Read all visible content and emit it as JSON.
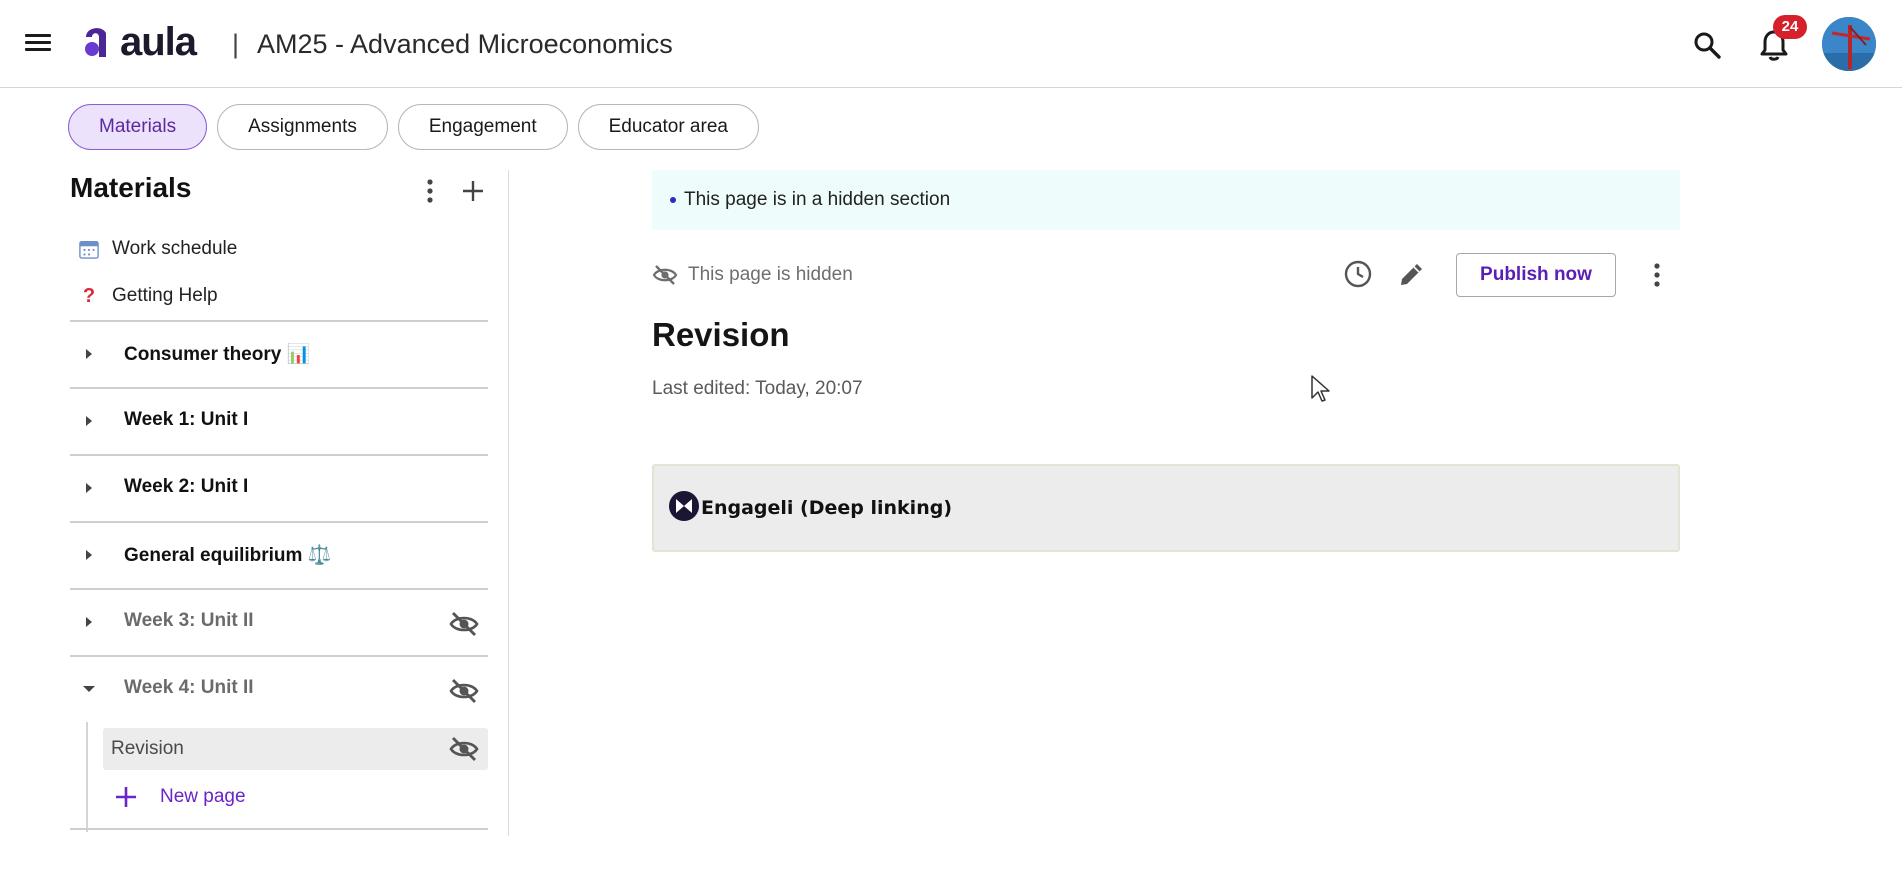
{
  "header": {
    "logo_text": "aula",
    "separator": "|",
    "course_title": "AM25 - Advanced Microeconomics",
    "notification_count": "24",
    "icons": [
      "menu-icon",
      "search-icon",
      "bell-icon",
      "avatar"
    ],
    "colors": {
      "brand": "#5b2a9e",
      "badge": "#d6202c"
    }
  },
  "tabs": [
    {
      "label": "Materials",
      "active": true
    },
    {
      "label": "Assignments",
      "active": false
    },
    {
      "label": "Engagement",
      "active": false
    },
    {
      "label": "Educator area",
      "active": false
    }
  ],
  "sidebar": {
    "title": "Materials",
    "links": [
      {
        "label": "Work schedule",
        "icon": "calendar-icon"
      },
      {
        "label": "Getting Help",
        "icon": "question-icon"
      }
    ],
    "sections": [
      {
        "label": "Consumer theory 📊",
        "expanded": false,
        "hidden": false
      },
      {
        "label": "Week 1: Unit I",
        "expanded": false,
        "hidden": false
      },
      {
        "label": "Week 2: Unit I",
        "expanded": false,
        "hidden": false
      },
      {
        "label": "General equilibrium ⚖️",
        "expanded": false,
        "hidden": false
      },
      {
        "label": "Week 3: Unit II",
        "expanded": false,
        "hidden": true
      },
      {
        "label": "Week 4: Unit II",
        "expanded": true,
        "hidden": true
      }
    ],
    "pages": [
      {
        "label": "Revision",
        "hidden": true,
        "selected": true
      }
    ],
    "new_page_label": "New page"
  },
  "main": {
    "notice": "This page is in a hidden section",
    "hidden_status": "This page is hidden",
    "publish_label": "Publish now",
    "title": "Revision",
    "last_edited": "Last edited: Today, 20:07",
    "embed_label": "Engageli (Deep linking)"
  }
}
